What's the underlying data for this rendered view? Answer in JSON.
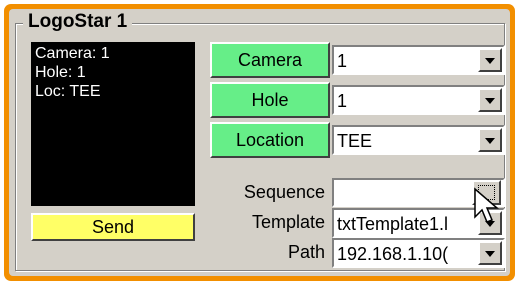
{
  "group": {
    "title": "LogoStar 1"
  },
  "display": {
    "lines": [
      "Camera: 1",
      "Hole: 1",
      "Loc: TEE"
    ]
  },
  "buttons": {
    "send": "Send",
    "camera": "Camera",
    "hole": "Hole",
    "location": "Location"
  },
  "labels": {
    "sequence": "Sequence",
    "template": "Template",
    "path": "Path"
  },
  "combos": {
    "camera": "1",
    "hole": "1",
    "location": "TEE",
    "template": "txtTemplate1.l",
    "path": "192.168.1.10("
  },
  "sequence": {
    "value": ""
  },
  "colors": {
    "frame": "#f28f00",
    "green_button": "#66ee88",
    "send_button": "#ffff66",
    "display_bg": "#000000"
  },
  "icons": [
    "browse-icon",
    "dropdown-arrow-icon",
    "mouse-cursor-icon"
  ]
}
